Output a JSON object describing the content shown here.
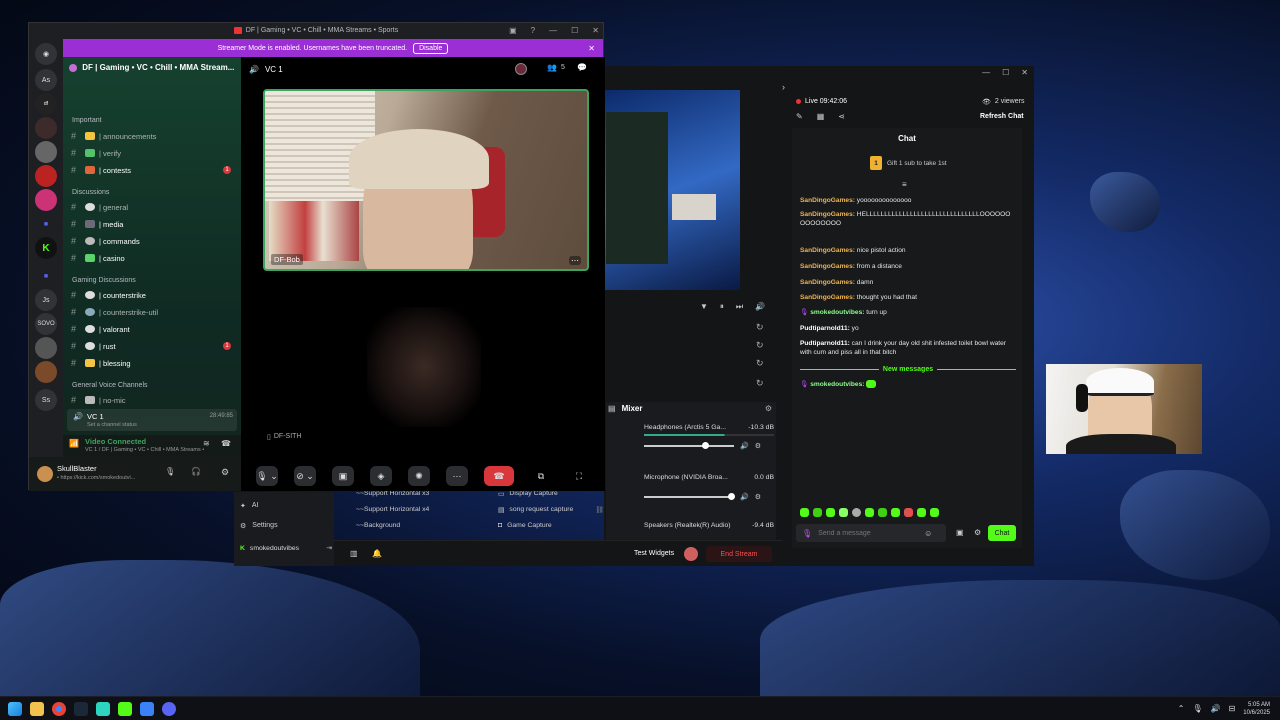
{
  "discord": {
    "window_title": "DF | Gaming • VC • Chill • MMA Streams • Sports",
    "banner_text": "Streamer Mode is enabled. Usernames have been truncated.",
    "banner_button": "Disable",
    "server_name": "DF | Gaming • VC • Chill • MMA Stream...",
    "guild_labels": [
      "As",
      "Js",
      "SOVO",
      "Ss"
    ],
    "categories": [
      "Important",
      "Discussions",
      "Gaming Discussions",
      "General Voice Channels"
    ],
    "channels": [
      {
        "name": "| announcements"
      },
      {
        "name": "| verify"
      },
      {
        "name": "| contests",
        "badge": "1"
      },
      {
        "name": "| general"
      },
      {
        "name": "| media"
      },
      {
        "name": "| commands"
      },
      {
        "name": "| casino"
      },
      {
        "name": "| counterstrike"
      },
      {
        "name": "| counterstrike-util"
      },
      {
        "name": "| valorant"
      },
      {
        "name": "| rust",
        "badge": "1"
      },
      {
        "name": "| blessing"
      },
      {
        "name": "| no-mic"
      }
    ],
    "voice_channel": {
      "name": "VC 1",
      "time": "28:49:85",
      "status": "Set a channel status"
    },
    "connection": {
      "status": "Video Connected",
      "detail": "VC 1 / DF | Gaming • VC • Chill • MMA Streams • Spo..."
    },
    "user": {
      "name": "SkullBlaster",
      "status": "• https://kick.com/smokedoutvi..."
    },
    "vc_header": "VC 1",
    "participant_count": "5",
    "tile_name": "DF-Bob",
    "second_participant": "DF-SITH"
  },
  "kick": {
    "live_label": "Live 09:42:06",
    "viewers": "2 viewers",
    "refresh_chat": "Refresh Chat",
    "chat_title": "Chat",
    "gift_text": "Gift 1 sub to take 1st",
    "gift_rank": "1",
    "messages": [
      {
        "user": "SanDingoGames:",
        "text": " yoooooooooooooo"
      },
      {
        "user": "SanDingoGames:",
        "text": " HELLLLLLLLLLLLLLLLLLLLLLLLLLLLLLLOOOOOOOOOOOOOO"
      },
      {
        "user": "SanDingoGames:",
        "text": " nice pistol action"
      },
      {
        "user": "SanDingoGames:",
        "text": " from a distance"
      },
      {
        "user": "SanDingoGames:",
        "text": " damn"
      },
      {
        "user": "SanDingoGames:",
        "text": " thought you had that"
      },
      {
        "user": "smokedoutvibes:",
        "text": " turn up"
      },
      {
        "user": "Pudtiparnold11:",
        "text": " yo"
      },
      {
        "user": "Pudtiparnold11:",
        "text": " can I drink your day old shit infested toilet bowl water with cum and piss all in that bitch"
      },
      {
        "user": "smokedoutvibes:",
        "text": ""
      }
    ],
    "new_messages": "New messages",
    "chat_placeholder": "Send a message",
    "chat_button": "Chat",
    "mixer_title": "Mixer",
    "mixer": [
      {
        "name": "Headphones (Arctis 5 Ga...",
        "db": "-10.3 dB",
        "level": 0.62
      },
      {
        "name": "Microphone (NVIDIA Broa...",
        "db": "0.0 dB",
        "level": 0.9
      },
      {
        "name": "Speakers (Realtek(R) Audio)",
        "db": "-9.4 dB",
        "level": 0.7
      }
    ],
    "scenes": [
      "~~Support Horizontal x3",
      "~~Support Horizontal x4",
      "~~Background"
    ],
    "sources": [
      "Display Capture",
      "song request capture",
      "Game Capture"
    ],
    "nav": [
      "AI",
      "Settings"
    ],
    "channel_name": "smokedoutvibes",
    "test_widgets": "Test Widgets",
    "end_stream": "End Stream"
  },
  "taskbar": {
    "time": "5:05 AM",
    "date": "10/6/2025"
  }
}
